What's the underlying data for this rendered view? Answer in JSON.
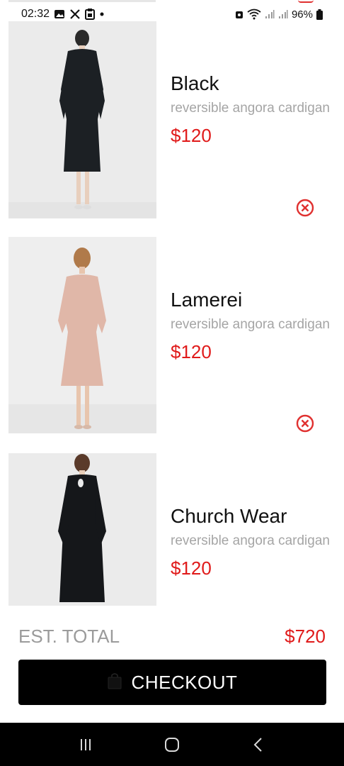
{
  "status_bar": {
    "time": "02:32",
    "battery": "96%",
    "left_icons": [
      "gallery-icon",
      "x-logo-icon",
      "app-icon",
      "dot-icon"
    ],
    "right_icons": [
      "lock-icon",
      "wifi-icon",
      "signal-icon",
      "signal-icon",
      "battery-icon"
    ]
  },
  "cart": {
    "items": [
      {
        "name": "Black",
        "description": "reversible angora cardigan",
        "price": "$120",
        "image": "black-dress-photo"
      },
      {
        "name": "Lamerei",
        "description": "reversible angora cardigan",
        "price": "$120",
        "image": "pink-dress-photo"
      },
      {
        "name": "Church Wear",
        "description": "reversible angora cardigan",
        "price": "$120",
        "image": "black-keyhole-dress-photo"
      }
    ]
  },
  "summary": {
    "total_label": "EST. TOTAL",
    "total_value": "$720"
  },
  "checkout": {
    "label": "CHECKOUT",
    "icon": "shopping-bag-icon"
  },
  "nav_bar": {
    "buttons": [
      "recent-apps-icon",
      "home-icon",
      "back-icon"
    ]
  },
  "colors": {
    "accent": "#e01a1a",
    "button_bg": "#000000",
    "muted_text": "#a5a5a5"
  }
}
